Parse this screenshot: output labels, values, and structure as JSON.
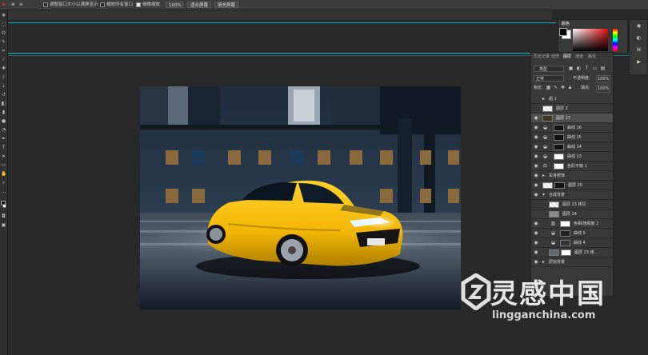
{
  "options_bar": {
    "resize_windows_label": "调整窗口大小以满屏显示",
    "zoom_all_label": "缩放所有窗口",
    "scrubby_zoom_label": "细微缩放",
    "zoom_value": "100%",
    "fit_screen_label": "适合屏幕",
    "fill_screen_label": "填充屏幕"
  },
  "panels": {
    "color_tab": "颜色",
    "layers_tabs": [
      "历史记录",
      "动作",
      "图层",
      "通道",
      "路径"
    ],
    "layers_active_tab": "图层",
    "kind_filter": "类型",
    "blend_mode": "正常",
    "opacity_label": "不透明度:",
    "opacity_value": "100%",
    "lock_label": "锁定:",
    "fill_label": "填充:",
    "fill_value": "100%",
    "layers": [
      {
        "name": "组 1",
        "type": "group",
        "visible": false
      },
      {
        "name": "图层 2",
        "type": "pixel",
        "visible": false
      },
      {
        "name": "图层 27",
        "type": "pixel",
        "visible": true,
        "selected": true
      },
      {
        "name": "曲线 16",
        "type": "adjustment",
        "visible": true
      },
      {
        "name": "曲线 15",
        "type": "adjustment",
        "visible": true
      },
      {
        "name": "曲线 14",
        "type": "adjustment",
        "visible": true
      },
      {
        "name": "曲线 13",
        "type": "adjustment",
        "visible": true
      },
      {
        "name": "色彩平衡 1",
        "type": "adjustment",
        "visible": true
      },
      {
        "name": "车身修饰",
        "type": "group",
        "visible": true
      },
      {
        "name": "图层 20",
        "type": "pixel",
        "visible": true
      },
      {
        "name": "合成背景",
        "type": "group",
        "visible": true
      },
      {
        "name": "图层 23 拷贝",
        "type": "pixel",
        "visible": false
      },
      {
        "name": "图层 24",
        "type": "pixel",
        "visible": false
      },
      {
        "name": "色相/饱和度 2",
        "type": "adjustment",
        "visible": true
      },
      {
        "name": "曲线 5",
        "type": "adjustment",
        "visible": true
      },
      {
        "name": "曲线 4",
        "type": "adjustment",
        "visible": true
      },
      {
        "name": "图层 23 拷...",
        "type": "pixel",
        "visible": true
      },
      {
        "name": "原始背景",
        "type": "group",
        "visible": true
      }
    ]
  },
  "watermark": {
    "brand": "灵感中国",
    "url": "lingganchina.com"
  },
  "colors": {
    "guide": "#17b4c8",
    "car_yellow": "#f2b705",
    "bg": "#282828"
  }
}
